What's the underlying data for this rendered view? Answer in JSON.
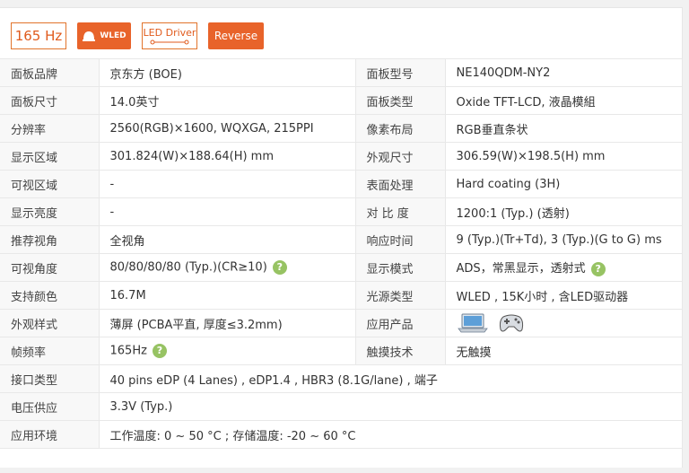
{
  "badges": {
    "hz": "165 Hz",
    "wled": "WLED",
    "led_driver": "LED Driver",
    "reverse": "Reverse"
  },
  "rows": [
    {
      "k1": "面板品牌",
      "v1": "京东方 (BOE)",
      "k2": "面板型号",
      "v2": "NE140QDM-NY2"
    },
    {
      "k1": "面板尺寸",
      "v1": "14.0英寸",
      "k2": "面板类型",
      "v2": "Oxide TFT-LCD, 液晶模組"
    },
    {
      "k1": "分辨率",
      "v1": "2560(RGB)×1600, WQXGA, 215PPI",
      "k2": "像素布局",
      "v2": "RGB垂直条状"
    },
    {
      "k1": "显示区域",
      "v1": "301.824(W)×188.64(H) mm",
      "k2": "外观尺寸",
      "v2": "306.59(W)×198.5(H) mm"
    },
    {
      "k1": "可视区域",
      "v1": "-",
      "k2": "表面处理",
      "v2": "Hard coating (3H)"
    },
    {
      "k1": "显示亮度",
      "v1": "-",
      "k2": "对 比 度",
      "v2": "1200:1 (Typ.) (透射)"
    },
    {
      "k1": "推荐视角",
      "v1": "全视角",
      "k2": "响应时间",
      "v2": "9 (Typ.)(Tr+Td), 3 (Typ.)(G to G) ms"
    },
    {
      "k1": "可视角度",
      "v1": "80/80/80/80 (Typ.)(CR≥10)",
      "k2": "显示模式",
      "v2": "ADS，常黑显示，透射式"
    },
    {
      "k1": "支持颜色",
      "v1": "16.7M",
      "k2": "光源类型",
      "v2": "WLED , 15K小时 , 含LED驱动器"
    },
    {
      "k1": "外观样式",
      "v1": "薄屏 (PCBA平直, 厚度≤3.2mm)",
      "k2": "应用产品",
      "v2": ""
    },
    {
      "k1": "帧频率",
      "v1": "165Hz",
      "k2": "触摸技术",
      "v2": "无触摸"
    }
  ],
  "full_rows": [
    {
      "k": "接口类型",
      "v": "40 pins   eDP (4 Lanes) , eDP1.4 , HBR3 (8.1G/lane) , 端子"
    },
    {
      "k": "电压供应",
      "v": "3.3V (Typ.)"
    },
    {
      "k": "应用环境",
      "v": "工作温度: 0 ~ 50 °C ; 存储温度: -20 ~ 60 °C"
    }
  ],
  "help_glyph": "?",
  "icons": {
    "laptop": "laptop-icon",
    "gamepad": "gamepad-icon",
    "help": "help-icon",
    "bulb": "bulb-icon"
  },
  "colors": {
    "accent": "#e8632a",
    "help": "#97c363"
  }
}
